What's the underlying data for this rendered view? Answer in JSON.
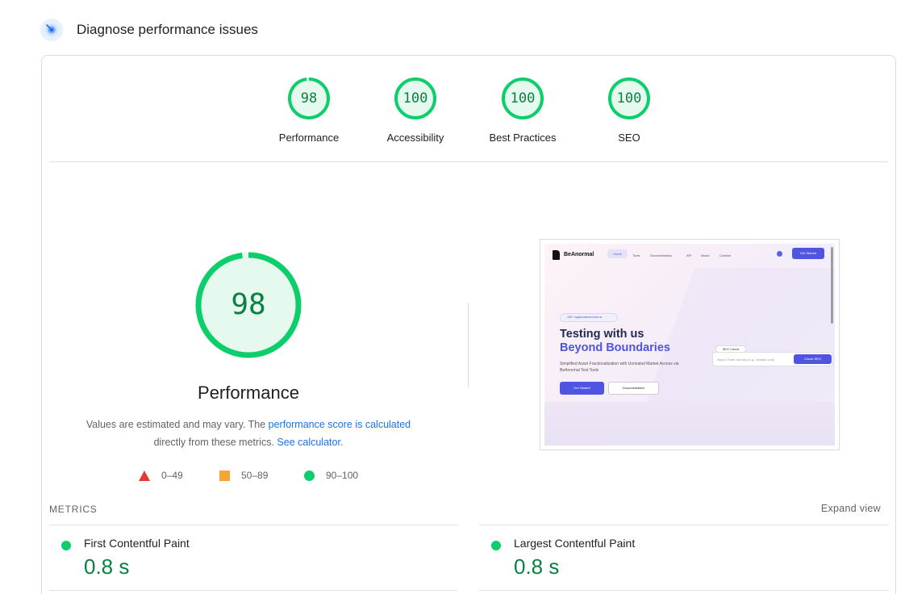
{
  "header": {
    "title": "Diagnose performance issues",
    "icon": "gauge-icon"
  },
  "categories": [
    {
      "score": "98",
      "label": "Performance",
      "fraction": 0.98
    },
    {
      "score": "100",
      "label": "Accessibility",
      "fraction": 1.0
    },
    {
      "score": "100",
      "label": "Best Practices",
      "fraction": 1.0
    },
    {
      "score": "100",
      "label": "SEO",
      "fraction": 1.0
    }
  ],
  "performance": {
    "score": "98",
    "fraction": 0.98,
    "label": "Performance",
    "desc_text_1": "Values are estimated and may vary. The ",
    "desc_link_1": "performance score is calculated",
    "desc_text_2": "directly from these metrics. ",
    "desc_link_2": "See calculator",
    "desc_text_3": "."
  },
  "legend": [
    {
      "shape": "triangle",
      "range": "0–49",
      "color": "#e53935"
    },
    {
      "shape": "square",
      "range": "50–89",
      "color": "#f4a535"
    },
    {
      "shape": "circle",
      "range": "90–100",
      "color": "#0cce6b"
    }
  ],
  "screenshot": {
    "logo": "BeAnormal",
    "nav": [
      "Home",
      "Tools",
      "Documentation",
      "API",
      "About",
      "Contact"
    ],
    "cta": "Get Started",
    "pill": "150+ organizations trust us",
    "hero_line1": "Testing with us",
    "hero_line2": "Beyond Boundaries",
    "subtitle": "Simplified Asset Fractionalization with Unrivaled Market Access via BeAnormal Test Tools",
    "btn_primary": "Get Started",
    "btn_secondary": "Documentation",
    "seo_tag": "SEO Check",
    "seo_placeholder": "https:// Enter domain (e.g., domain.com)",
    "seo_button": "Check SEO"
  },
  "metrics": {
    "title": "METRICS",
    "expand": "Expand view",
    "items": [
      {
        "name": "First Contentful Paint",
        "value": "0.8 s"
      },
      {
        "name": "Largest Contentful Paint",
        "value": "0.8 s"
      }
    ]
  },
  "colors": {
    "pass": "#0cce6b",
    "pass_text": "#0b8043",
    "pass_fill": "#e6f9ef",
    "link": "#1a73e8"
  }
}
